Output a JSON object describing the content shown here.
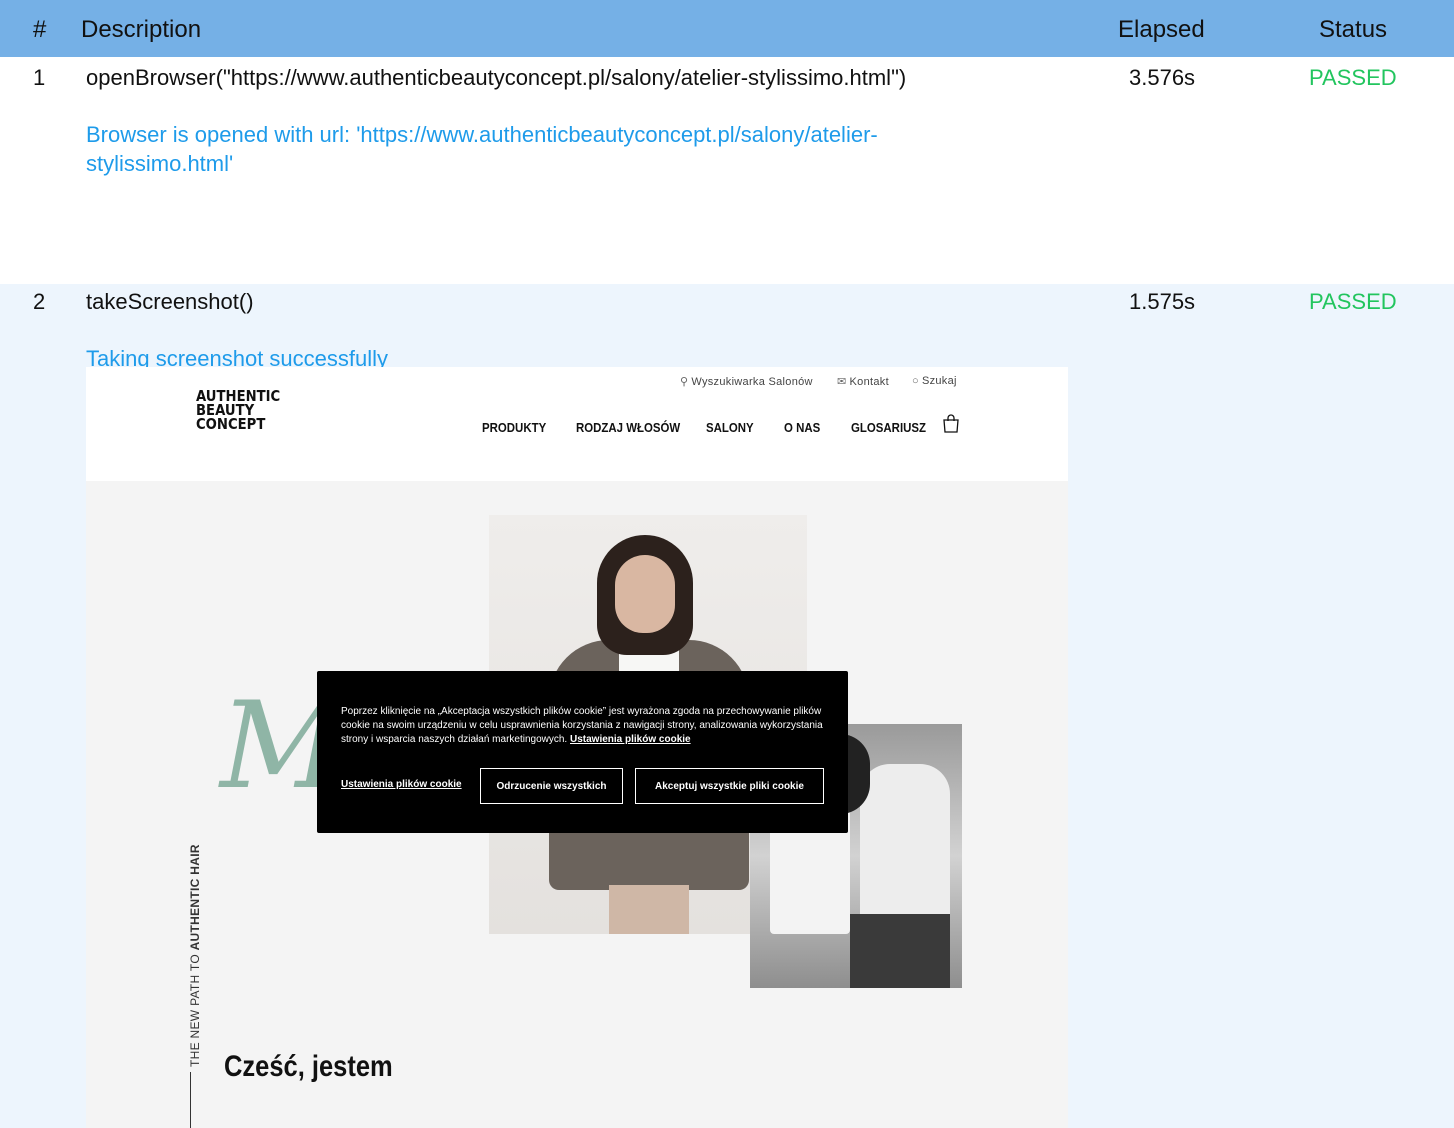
{
  "table": {
    "headers": {
      "num": "#",
      "description": "Description",
      "elapsed": "Elapsed",
      "status": "Status"
    },
    "rows": [
      {
        "num": "1",
        "command": "openBrowser(\"https://www.authenticbeautyconcept.pl/salony/atelier-stylissimo.html\")",
        "elapsed": "3.576s",
        "status": "PASSED",
        "message": "Browser is opened with url: 'https://www.authenticbeautyconcept.pl/salony/atelier-stylissimo.html'"
      },
      {
        "num": "2",
        "command": "takeScreenshot()",
        "elapsed": "1.575s",
        "status": "PASSED",
        "message": "Taking screenshot successfully"
      }
    ]
  },
  "screenshot": {
    "logo": [
      "AUTHENTIC",
      "BEAUTY",
      "CONCEPT"
    ],
    "utility": [
      {
        "icon": "location-pin-icon",
        "label": "Wyszukiwarka Salonów"
      },
      {
        "icon": "envelope-icon",
        "label": "Kontakt"
      },
      {
        "icon": "search-icon",
        "label": "Szukaj"
      }
    ],
    "nav": [
      "PRODUKTY",
      "RODZAJ WŁOSÓW",
      "SALONY",
      "O NAS",
      "GLOSARIUSZ"
    ],
    "script_text": "Ma",
    "vertical_text_light": "THE NEW PATH TO ",
    "vertical_text_bold": "AUTHENTIC HAIR",
    "hello": "Cześć, jestem",
    "cookie": {
      "text": "Poprzez kliknięcie na „Akceptacja wszystkich plików cookie” jest wyrażona zgoda na przechowywanie plików cookie na swoim urządzeniu w celu usprawnienia korzystania z nawigacji strony, analizowania wykorzystania strony i wsparcia naszych działań marketingowych.",
      "settings_link": "Ustawienia plików cookie",
      "settings_button": "Ustawienia plików cookie",
      "reject_button": "Odrzucenie wszystkich",
      "accept_button": "Akceptuj wszystkie pliki cookie"
    },
    "colors": {
      "script": "#8fb5a6",
      "passed": "#22c55e",
      "message": "#1e9bea",
      "header_bg": "#75b0e6"
    }
  }
}
